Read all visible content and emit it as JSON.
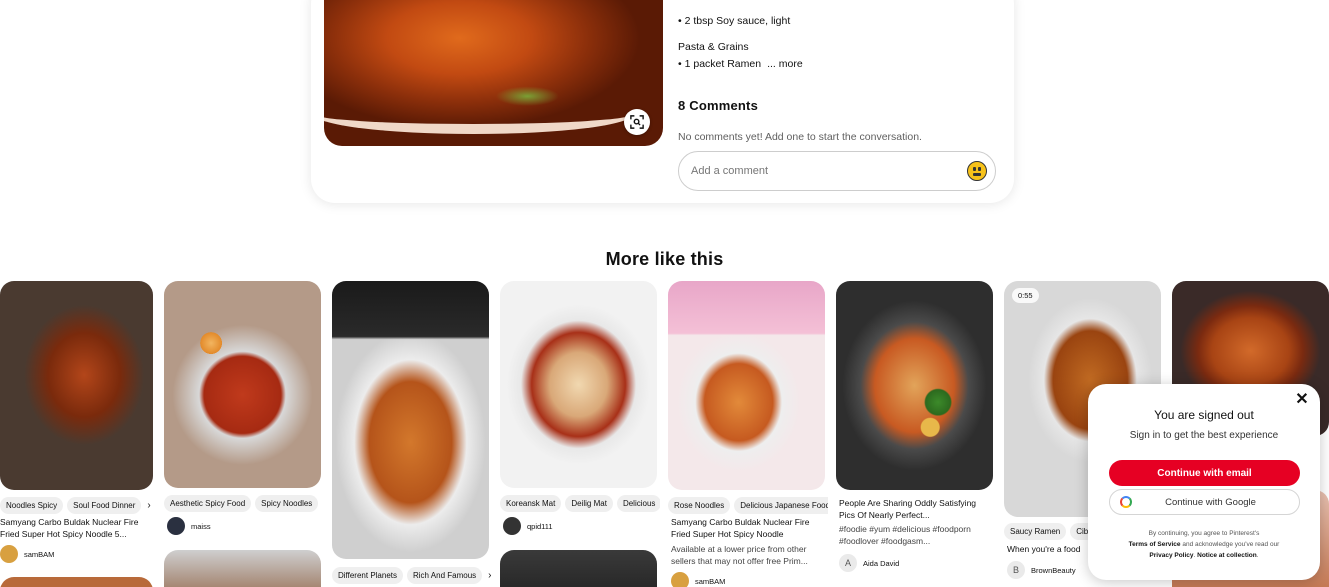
{
  "pin_detail": {
    "ingredients": [
      {
        "text": "• 2 tbsp Soy sauce, light"
      },
      {
        "text": "Pasta & Grains"
      },
      {
        "text": "• 1 packet Ramen"
      }
    ],
    "more_label": "... more",
    "comments_title": "8 Comments",
    "no_comments": "No comments yet! Add one to start the conversation.",
    "comment_placeholder": "Add a comment"
  },
  "section_title": "More like this",
  "pins": [
    {
      "tags": [
        "Noodles Spicy",
        "Soul Food Dinner"
      ],
      "title": "Samyang Carbo Buldak Nuclear Fire Fried Super Hot Spicy Noodle 5...",
      "creator": "samBAM"
    },
    {
      "tags": [
        "Aesthetic Spicy Food",
        "Spicy Noodles"
      ],
      "creator": "maiss"
    },
    {
      "tags": [
        "Different Planets",
        "Rich And Famous"
      ]
    },
    {
      "tags": [
        "Koreansk Mat",
        "Deilig Mat",
        "Delicious"
      ],
      "creator": "qpid111"
    },
    {
      "tags": [
        "Rose Noodles",
        "Delicious Japanese Food"
      ],
      "title": "Samyang Carbo Buldak Nuclear Fire Fried Super Hot Spicy Noodle",
      "subtitle": "Available at a lower price from other sellers that may not offer free Prim...",
      "creator": "samBAM"
    },
    {
      "title": "People Are Sharing Oddly Satisfying Pics Of Nearly Perfect...",
      "subtitle": "#foodie #yum #delicious #foodporn #foodlover #foodgasm...",
      "creator": "Aida David",
      "creator_initial": "A"
    },
    {
      "video_time": "0:55",
      "tags": [
        "Saucy Ramen",
        "Cibo"
      ],
      "title": "When you're a food",
      "creator": "BrownBeauty",
      "creator_initial": "B"
    }
  ],
  "signed_out": {
    "title": "You are signed out",
    "subtitle": "Sign in to get the best experience",
    "email_button": "Continue with email",
    "google_button": "Continue with Google",
    "legal_1": "By continuing, you agree to Pinterest's",
    "legal_tos": "Terms of Service",
    "legal_2": "and acknowledge you've read our",
    "legal_privacy": "Privacy Policy",
    "legal_3": ". ",
    "legal_notice": "Notice at collection",
    "legal_4": "."
  },
  "colors": {
    "brand_red": "#e60023"
  }
}
